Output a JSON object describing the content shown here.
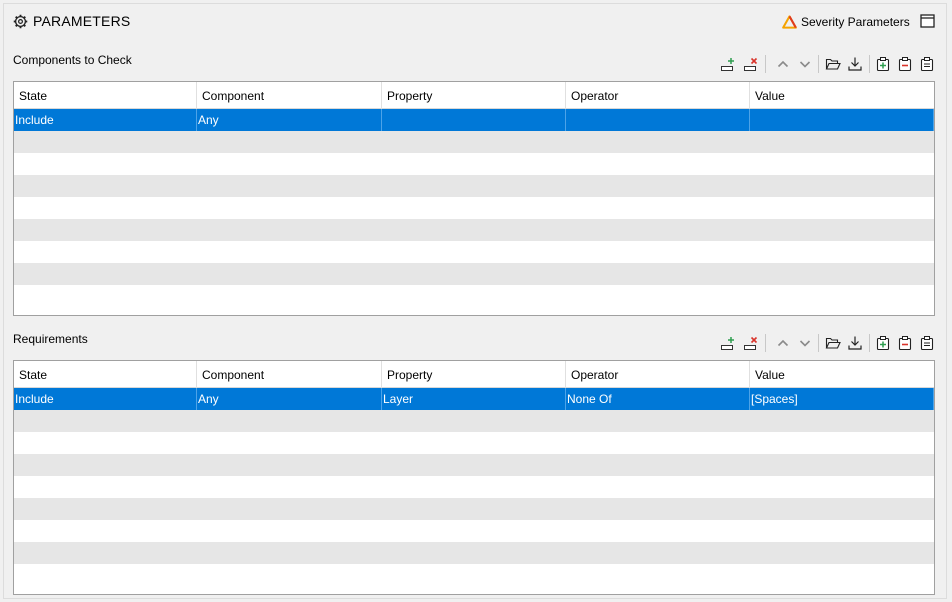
{
  "header": {
    "title": "PARAMETERS",
    "severity_label": "Severity Parameters",
    "icons": {
      "title": "gear-icon",
      "severity": "severity-triangle-icon",
      "window": "window-icon"
    }
  },
  "colors": {
    "selection": "#0078d7",
    "add_green": "#2e9e4f",
    "remove_red": "#d9342b",
    "severity_orange": "#f5a300",
    "severity_red": "#e03a1e"
  },
  "toolbar_icons": [
    "add-row-icon",
    "remove-row-icon",
    "move-up-icon",
    "move-down-icon",
    "open-folder-icon",
    "download-icon",
    "add-item-icon",
    "remove-item-icon",
    "clear-item-icon"
  ],
  "components": {
    "label": "Components to Check",
    "columns": [
      "State",
      "Component",
      "Property",
      "Operator",
      "Value"
    ],
    "rows": [
      [
        "Include",
        "Any",
        "",
        "",
        ""
      ]
    ],
    "selected_row": 0
  },
  "requirements": {
    "label": "Requirements",
    "columns": [
      "State",
      "Component",
      "Property",
      "Operator",
      "Value"
    ],
    "rows": [
      [
        "Include",
        "Any",
        "Layer",
        "None Of",
        "[Spaces]"
      ]
    ],
    "selected_row": 0
  }
}
